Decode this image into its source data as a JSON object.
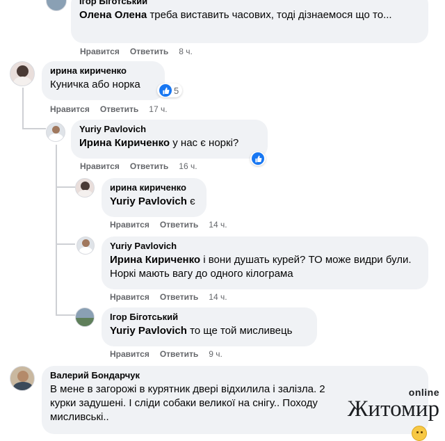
{
  "actions": {
    "like": "Нравится",
    "reply": "Ответить"
  },
  "comments": [
    {
      "author": "Ігор Біготський",
      "mention": "Олена Олена",
      "text": "треба виставить часових, тоді дізнаемося що то...",
      "time": "8 ч."
    },
    {
      "author": "ирина кириченко",
      "mention": "",
      "text": "Куничка або норка",
      "reactions": "5",
      "time": "17 ч."
    },
    {
      "author": "Yuriy Pavlovich",
      "mention": "Ирина Кириченко",
      "text": "у нас є норкі?",
      "time": "16 ч."
    },
    {
      "author": "ирина кириченко",
      "mention": "Yuriy Pavlovich",
      "text": "є",
      "time": "14 ч."
    },
    {
      "author": "Yuriy Pavlovich",
      "mention": "Ирина Кириченко",
      "text": "і вони душать курей? ТО може видри були. Норкі мають вагу до одного кілограма",
      "time": "14 ч."
    },
    {
      "author": "Ігор Біготський",
      "mention": "Yuriy Pavlovich",
      "text": "то ще той мисливець",
      "time": "9 ч."
    },
    {
      "author": "Валерий Бондарчук",
      "mention": "",
      "text": "В мене в загорожі в курятник двері відхилила і залізла. 2 курки задушені. І сліди собаки великої на снігу.. Походу мисливські.."
    }
  ],
  "watermark": {
    "top": "online",
    "name": "Житомир"
  },
  "icons": {
    "like": "like-thumb-icon",
    "emoji": "emoji-smile-icon"
  },
  "colors": {
    "bubble": "#f0f2f5",
    "muted": "#65676b",
    "like_blue": "#1877f2"
  }
}
